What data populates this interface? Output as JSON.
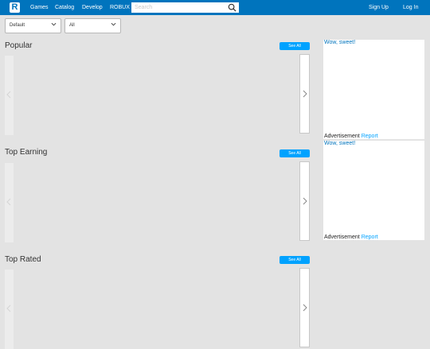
{
  "header": {
    "logo_letter": "R",
    "nav": [
      "Games",
      "Catalog",
      "Develop",
      "ROBUX"
    ],
    "search_placeholder": "Search",
    "sign_up": "Sign Up",
    "log_in": "Log In"
  },
  "filters": {
    "sort": "Default",
    "genre": "All"
  },
  "sections": [
    {
      "title": "Popular",
      "see_all": "See All"
    },
    {
      "title": "Top Earning",
      "see_all": "See All"
    },
    {
      "title": "Top Rated",
      "see_all": "See All"
    }
  ],
  "ads": [
    {
      "image_alt": "Wow, sweet!",
      "label": "Advertisement",
      "report": "Report"
    },
    {
      "image_alt": "Wow, sweet!",
      "label": "Advertisement",
      "report": "Report"
    }
  ],
  "colors": {
    "topbar": "#0074bd",
    "button": "#00a2ff",
    "background": "#e3e3e3"
  }
}
